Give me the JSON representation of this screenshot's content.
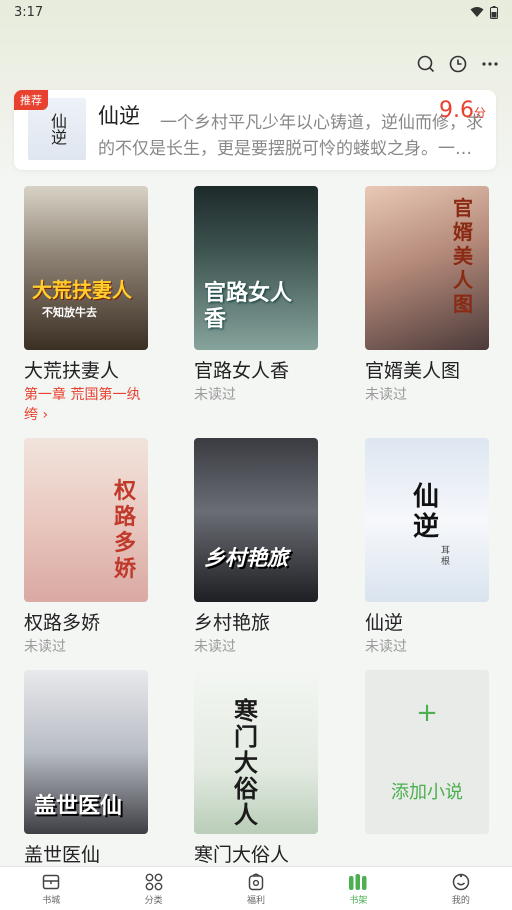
{
  "status_bar": {
    "time": "3:17"
  },
  "recommend": {
    "badge": "推荐",
    "title": "仙逆",
    "cover_text": "仙逆",
    "description": "一个乡村平凡少年以心铸道，逆仙而修，求的不仅是长生，更是要摆脱可怜的蝼蚁之身。一…",
    "score": "9.6",
    "score_unit": "分"
  },
  "books": [
    {
      "title": "大荒扶妻人",
      "sub": "第一章 荒国第一纨绔 ›",
      "sub_red": true,
      "cover_text": "大荒扶妻人",
      "cover_sub": "不知放牛去"
    },
    {
      "title": "官路女人香",
      "sub": "未读过",
      "cover_text": "官路女人香"
    },
    {
      "title": "官婿美人图",
      "sub": "未读过",
      "cover_text": "官婿美人图"
    },
    {
      "title": "权路多娇",
      "sub": "未读过",
      "cover_text": "权路多娇"
    },
    {
      "title": "乡村艳旅",
      "sub": "未读过",
      "cover_text": "乡村艳旅"
    },
    {
      "title": "仙逆",
      "sub": "未读过",
      "cover_text": "仙逆",
      "cover_sub": "耳根"
    },
    {
      "title": "盖世医仙",
      "sub": "",
      "cover_text": "盖世医仙"
    },
    {
      "title": "寒门大俗人",
      "sub": "",
      "cover_text": "寒门大俗人"
    }
  ],
  "add_card": {
    "plus": "+",
    "label": "添加小说"
  },
  "tabs": [
    {
      "label": "书城",
      "icon": "bookstore-icon"
    },
    {
      "label": "分类",
      "icon": "category-icon"
    },
    {
      "label": "福利",
      "icon": "welfare-icon"
    },
    {
      "label": "书架",
      "icon": "bookshelf-icon",
      "active": true
    },
    {
      "label": "我的",
      "icon": "profile-icon"
    }
  ],
  "colors": {
    "accent": "#4caf50",
    "badge": "#e8412f"
  }
}
